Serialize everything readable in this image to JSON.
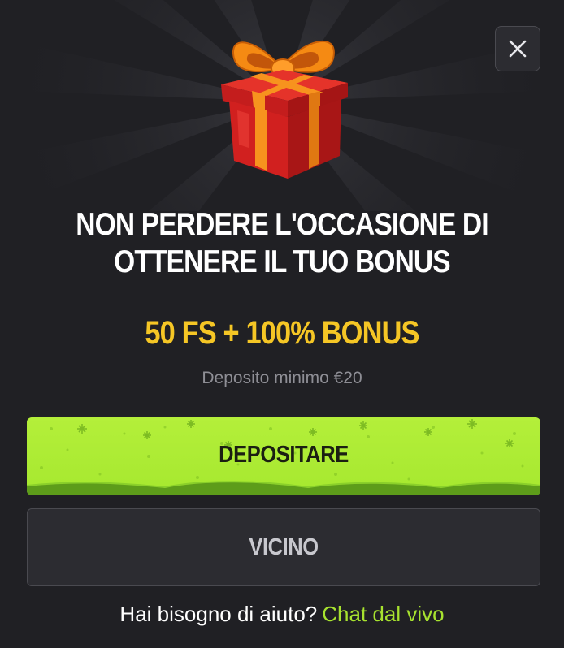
{
  "modal": {
    "headline_line1": "NON PERDERE L'OCCASIONE DI",
    "headline_line2": "OTTENERE IL TUO BONUS",
    "offer": "50 FS + 100% BONUS",
    "min_deposit": "Deposito minimo €20",
    "deposit_button": "DEPOSITARE",
    "close_button": "VICINO",
    "help_text": "Hai bisogno di aiuto?",
    "help_link": "Chat dal vivo"
  },
  "icons": {
    "close": "close-icon",
    "gift": "gift-box-icon"
  },
  "colors": {
    "background": "#202024",
    "offer": "#f5c625",
    "deposit_button": "#a6e82f",
    "help_link": "#a7e22f",
    "secondary_button": "#2c2c31"
  }
}
